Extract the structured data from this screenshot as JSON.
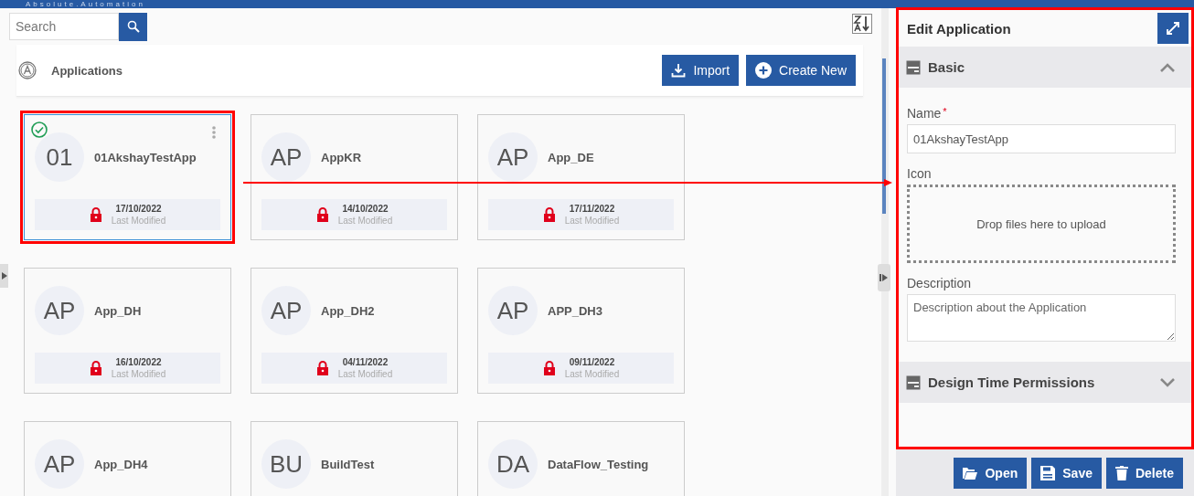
{
  "brand": "Absolute.Automation",
  "search": {
    "placeholder": "Search"
  },
  "section": {
    "title": "Applications",
    "buttons": [
      {
        "kind": "import",
        "label": "Import"
      },
      {
        "kind": "create",
        "label": "Create New"
      }
    ]
  },
  "apps": [
    {
      "initials": "01",
      "name": "01AkshayTestApp",
      "date": "17/10/2022",
      "date_label": "Last Modified",
      "locked": true,
      "selected": true,
      "highlighted": true
    },
    {
      "initials": "AP",
      "name": "AppKR",
      "date": "14/10/2022",
      "date_label": "Last Modified",
      "locked": true,
      "selected": false,
      "highlighted": false
    },
    {
      "initials": "AP",
      "name": "App_DE",
      "date": "17/11/2022",
      "date_label": "Last Modified",
      "locked": true,
      "selected": false,
      "highlighted": false
    },
    {
      "initials": "AP",
      "name": "App_DH",
      "date": "16/10/2022",
      "date_label": "Last Modified",
      "locked": true,
      "selected": false,
      "highlighted": false
    },
    {
      "initials": "AP",
      "name": "App_DH2",
      "date": "04/11/2022",
      "date_label": "Last Modified",
      "locked": true,
      "selected": false,
      "highlighted": false
    },
    {
      "initials": "AP",
      "name": "APP_DH3",
      "date": "09/11/2022",
      "date_label": "Last Modified",
      "locked": true,
      "selected": false,
      "highlighted": false
    },
    {
      "initials": "AP",
      "name": "App_DH4",
      "selected": false,
      "highlighted": false
    },
    {
      "initials": "BU",
      "name": "BuildTest",
      "selected": false,
      "highlighted": false
    },
    {
      "initials": "DA",
      "name": "DataFlow_Testing",
      "selected": false,
      "highlighted": false
    }
  ],
  "panel": {
    "title": "Edit Application",
    "highlighted": true,
    "sections": [
      {
        "title": "Basic",
        "expanded": true,
        "fields": [
          {
            "kind": "text",
            "label": "Name",
            "required_mark": "*",
            "value": "01AkshayTestApp"
          },
          {
            "kind": "upload",
            "label": "Icon",
            "hint": "Drop files here to upload"
          },
          {
            "kind": "textarea",
            "label": "Description",
            "placeholder": "Description about the Application"
          }
        ]
      },
      {
        "title": "Design Time Permissions",
        "expanded": false
      }
    ],
    "buttons": [
      {
        "kind": "open",
        "label": "Open"
      },
      {
        "kind": "save",
        "label": "Save"
      },
      {
        "kind": "delete",
        "label": "Delete"
      }
    ]
  }
}
